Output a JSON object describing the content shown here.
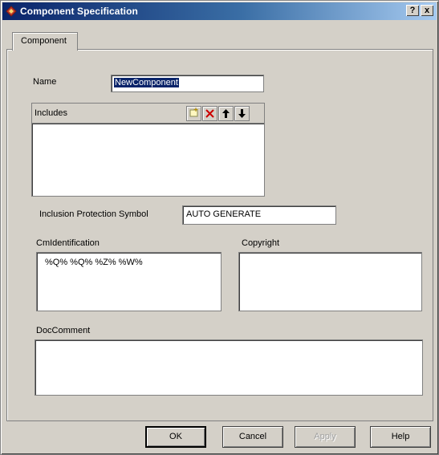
{
  "window": {
    "title": "Component Specification",
    "help_button": "?",
    "close_button": "x"
  },
  "tabs": [
    {
      "label": "Component",
      "active": true
    }
  ],
  "form": {
    "name": {
      "label": "Name",
      "value": "NewComponent"
    },
    "includes": {
      "label": "Includes",
      "items": []
    },
    "inclusion_protection": {
      "label": "Inclusion Protection Symbol",
      "value": "AUTO GENERATE"
    },
    "cm_identification": {
      "label": "CmIdentification",
      "value": "%Q% %Q% %Z% %W%"
    },
    "copyright": {
      "label": "Copyright",
      "value": ""
    },
    "doc_comment": {
      "label": "DocComment",
      "value": ""
    }
  },
  "buttons": {
    "ok": "OK",
    "cancel": "Cancel",
    "apply": "Apply",
    "help": "Help"
  },
  "colors": {
    "title_gradient_start": "#0a246a",
    "title_gradient_end": "#a6caf0",
    "dialog_face": "#d4d0c8",
    "selection": "#0a246a",
    "delete_icon": "#cc0000"
  }
}
